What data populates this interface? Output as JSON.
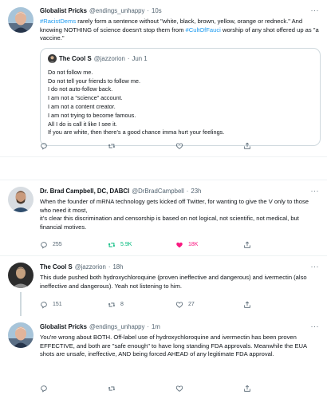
{
  "colors": {
    "link": "#1d9bf0",
    "retweet_active": "#00ba7c",
    "like_active": "#f91880",
    "muted": "#536471"
  },
  "tweets": [
    {
      "name": "Globalist Pricks",
      "handle": "@endings_unhappy",
      "sep": "·",
      "time": "10s",
      "text": {
        "tag1": "#RacistDems",
        "p1": " rarely form a sentence without \"white, black, brown, yellow, orange or redneck.\" And knowing NOTHING of science doesn't stop them from ",
        "tag2": "#CultOfFauci",
        "p2": " worship of any shot offered up as \"a vaccine.\""
      },
      "quote": {
        "name": "The Cool S",
        "handle": "@jazzorion",
        "sep": "·",
        "time": "Jun 1",
        "lines": [
          "Do not follow me.",
          "Do not tell your friends to follow me.",
          "I do not auto-follow back.",
          "I am not a “science” account.",
          "I am not a content creator.",
          "I am not trying to become famous.",
          "All I do is call it like I see it.",
          "If you are white, then there’s a good chance imma hurt your feelings."
        ]
      },
      "actions": {
        "replies": "",
        "retweets": "",
        "likes": ""
      }
    },
    {
      "name": "Dr. Brad Campbell, DC, DABCI",
      "handle": "@DrBradCampbell",
      "sep": "·",
      "time": "23h",
      "text": "When the founder of mRNA technology gets kicked off Twitter, for wanting to give the V only to those who need it most,\nit’s clear this discrimination and censorship is based on not logical, not scientific, not medical, but financial motives.",
      "actions": {
        "replies": "255",
        "retweets": "5.9K",
        "likes": "18K"
      }
    },
    {
      "name": "The Cool S",
      "handle": "@jazzorion",
      "sep": "·",
      "time": "18h",
      "text": "This dude pushed both hydroxychloroquine (proven ineffective and dangerous) and ivermectin (also ineffective and dangerous). Yeah not listening to him.",
      "actions": {
        "replies": "151",
        "retweets": "8",
        "likes": "27"
      }
    },
    {
      "name": "Globalist Pricks",
      "handle": "@endings_unhappy",
      "sep": "·",
      "time": "1m",
      "text": "You're wrong about BOTH.  Off-label use of hydroxychloroquine and ivermectin has been proven EFFECTIVE, and both are \"safe enough\" to have long standing FDA approvals. Meanwhile the EUA shots are unsafe, ineffective, AND being forced AHEAD of any legitimate FDA approval.",
      "actions": {
        "replies": "",
        "retweets": "",
        "likes": ""
      }
    }
  ]
}
